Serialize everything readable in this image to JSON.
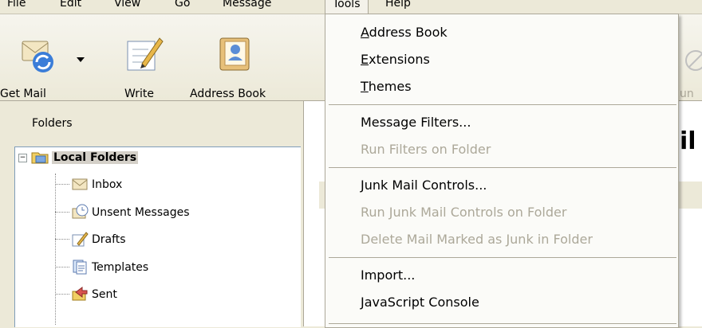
{
  "menubar": {
    "items": [
      "File",
      "Edit",
      "View",
      "Go",
      "Message",
      "Tools",
      "Help"
    ],
    "active": "Tools"
  },
  "toolbar": {
    "get_mail_label": "Get Mail",
    "write_label": "Write",
    "address_book_label": "Address Book",
    "truncated_label": "un"
  },
  "folder_pane": {
    "header": "Folders",
    "root": "Local Folders",
    "folders": [
      "Inbox",
      "Unsent Messages",
      "Drafts",
      "Templates",
      "Sent"
    ]
  },
  "message_pane": {
    "partial_heading": "il"
  },
  "tools_menu": {
    "items": [
      {
        "label": "Address Book",
        "enabled": true
      },
      {
        "label": "Extensions",
        "enabled": true
      },
      {
        "label": "Themes",
        "enabled": true
      },
      {
        "label": "Message Filters...",
        "enabled": true
      },
      {
        "label": "Run Filters on Folder",
        "enabled": false
      },
      {
        "label": "Junk Mail Controls...",
        "enabled": true
      },
      {
        "label": "Run Junk Mail Controls on Folder",
        "enabled": false
      },
      {
        "label": "Delete Mail Marked as Junk in Folder",
        "enabled": false
      },
      {
        "label": "Import...",
        "enabled": true
      },
      {
        "label": "JavaScript Console",
        "enabled": true
      }
    ]
  },
  "colors": {
    "chrome": "#ece9d8",
    "disabled_text": "#aca899",
    "selection": "#d4d0c8"
  }
}
